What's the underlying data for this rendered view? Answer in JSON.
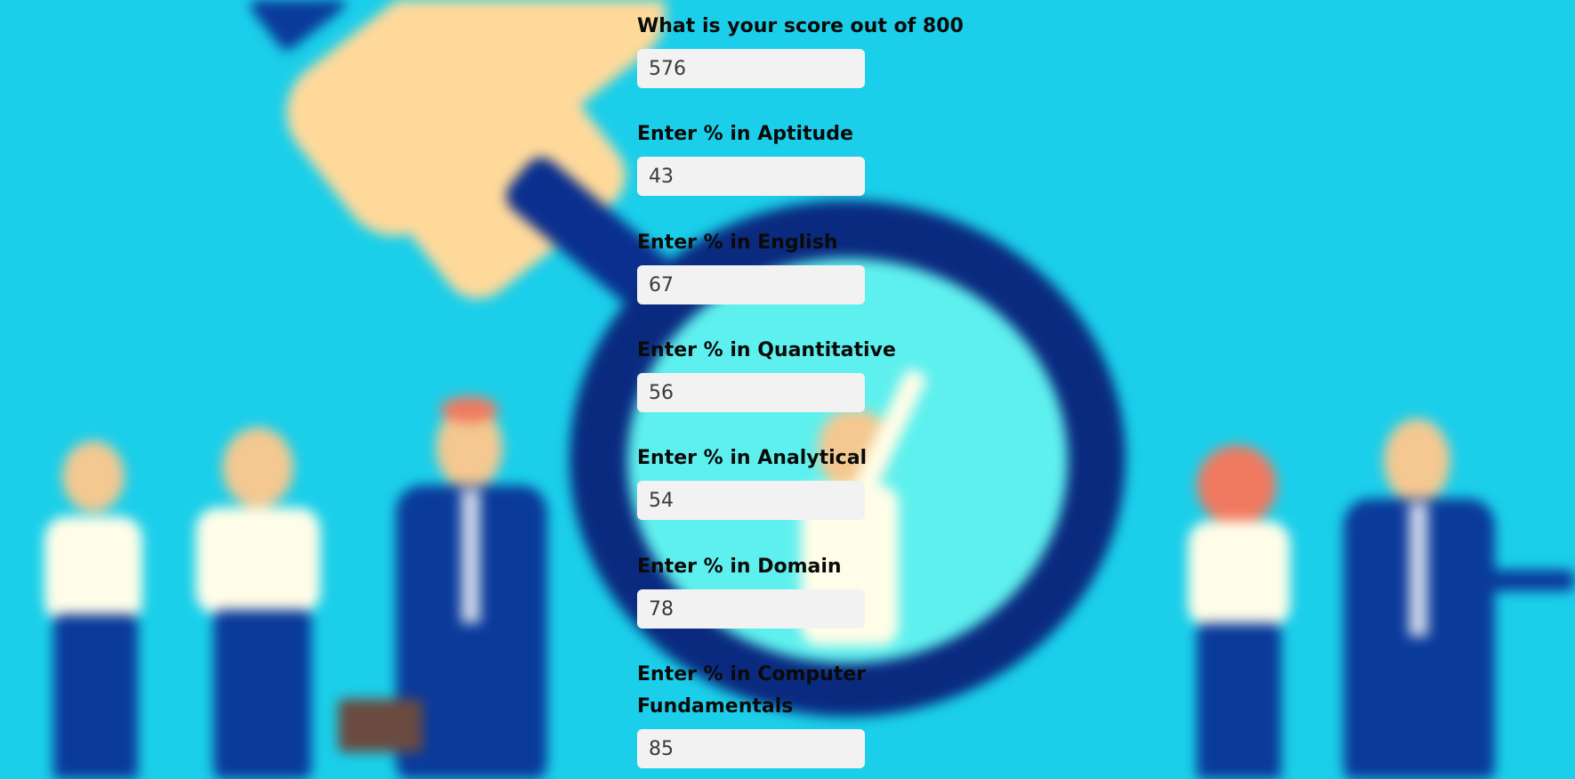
{
  "fields": [
    {
      "label": "What is your score out of 800",
      "value": "576"
    },
    {
      "label": "Enter % in Aptitude",
      "value": "43"
    },
    {
      "label": "Enter % in English",
      "value": "67"
    },
    {
      "label": "Enter % in Quantitative",
      "value": "56"
    },
    {
      "label": "Enter % in Analytical",
      "value": "54"
    },
    {
      "label": "Enter % in Domain",
      "value": "78"
    },
    {
      "label": "Enter % in Computer Fundamentals",
      "value": "85"
    }
  ],
  "colors": {
    "background": "#1bcfea",
    "magnifier_ring": "#0a2a80",
    "hand": "#ffd99a",
    "input_bg": "#f2f2f2"
  }
}
